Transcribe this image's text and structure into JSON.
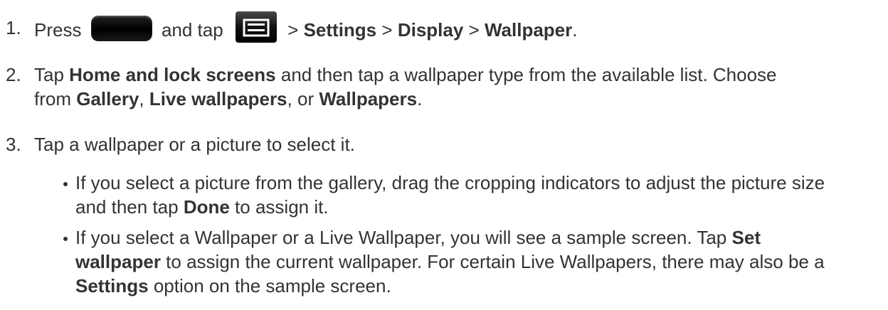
{
  "steps": [
    {
      "number": "1.",
      "parts": {
        "press": "Press",
        "and_tap": "and tap",
        "sep1": ">",
        "settings": "Settings",
        "sep2": ">",
        "display": "Display",
        "sep3": ">",
        "wallpaper": "Wallpaper",
        "end": "."
      },
      "icons": [
        "home-key-icon",
        "menu-key-icon"
      ]
    },
    {
      "number": "2.",
      "parts": {
        "tap": "Tap",
        "home_lock": "Home and lock screens",
        "mid": "and then tap a wallpaper type from the available list. Choose",
        "from": "from",
        "gallery": "Gallery",
        "comma1": ",",
        "live": "Live wallpapers",
        "comma_or": ", or",
        "wallpapers": "Wallpapers",
        "end": "."
      }
    },
    {
      "number": "3.",
      "text": "Tap a wallpaper or a picture to select it."
    }
  ],
  "bullets": [
    {
      "line1": "If you select a picture from the gallery, drag the cropping indicators to adjust the picture size",
      "line2_pre": "and then tap",
      "done": "Done",
      "line2_post": "to assign it."
    },
    {
      "line1_pre": "If you select a Wallpaper or a Live Wallpaper, you will see a sample screen. Tap",
      "set": "Set",
      "wallpaper": "wallpaper",
      "line2_post": "to assign the current wallpaper. For certain Live Wallpapers, there may also be a",
      "settings": "Settings",
      "line3_post": "option on the sample screen."
    }
  ]
}
